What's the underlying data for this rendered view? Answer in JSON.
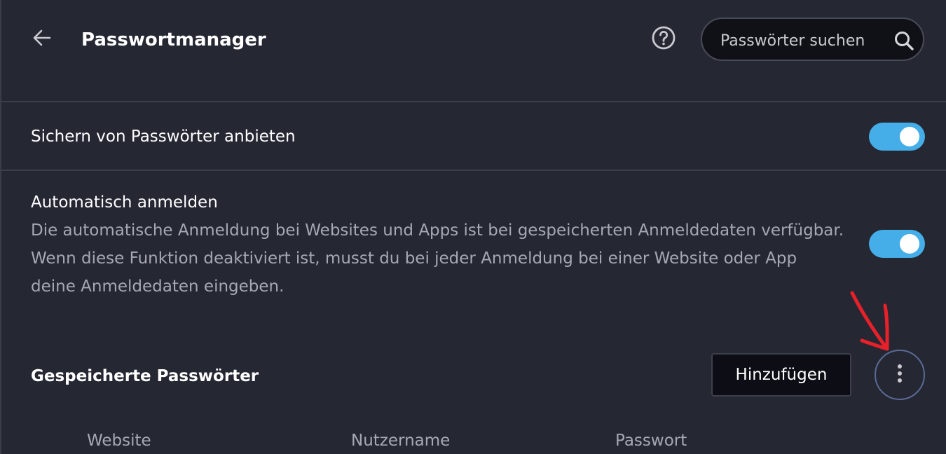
{
  "header": {
    "back_icon": "arrow-left-icon",
    "title": "Passwortmanager",
    "help_icon": "help-circle-icon",
    "search": {
      "placeholder": "Passwörter suchen",
      "value": "",
      "icon": "search-icon"
    }
  },
  "settings": [
    {
      "label": "Sichern von Passwörter anbieten",
      "enabled": true
    },
    {
      "label": "Automatisch anmelden",
      "description_lines": [
        "Die automatische Anmeldung bei Websites und Apps ist bei gespeicherten Anmeldedaten verfügbar.",
        "Wenn diese Funktion deaktiviert ist, musst du bei jeder Anmeldung bei einer Website oder App",
        "deine Anmeldedaten eingeben."
      ],
      "enabled": true
    }
  ],
  "saved_passwords": {
    "title": "Gespeicherte Passwörter",
    "add_label": "Hinzufügen",
    "more_icon": "more-vertical-icon",
    "columns": [
      "Website",
      "Nutzername",
      "Passwort"
    ]
  },
  "colors": {
    "background": "#252733",
    "toggle_on": "#45aee8",
    "annotation": "#e8202a"
  }
}
